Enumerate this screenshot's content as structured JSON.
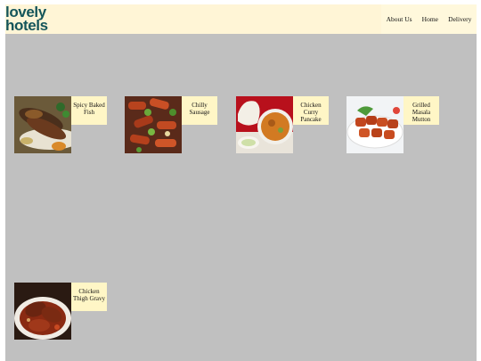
{
  "logo": {
    "line1": "lovely",
    "line2": "hotels"
  },
  "nav": {
    "about": "About Us",
    "home": "Home",
    "delivery": "Delivery"
  },
  "dishes": [
    {
      "name": "Spicy Baked Fish",
      "image_icon": "grilled-fish-photo"
    },
    {
      "name": "Chilly Sausage",
      "image_icon": "chilli-sausage-photo"
    },
    {
      "name": "Chicken Curry Pancake",
      "image_icon": "curry-pancake-photo"
    },
    {
      "name": "Grilled Masala Mutton",
      "image_icon": "masala-mutton-photo"
    },
    {
      "name": "Chicken Thigh Gravy",
      "image_icon": "chicken-gravy-photo"
    }
  ],
  "colors": {
    "page_background": "#c0c0c0",
    "header_background": "#fff5d6",
    "label_background": "#fff6c6",
    "logo": "#14555a"
  }
}
